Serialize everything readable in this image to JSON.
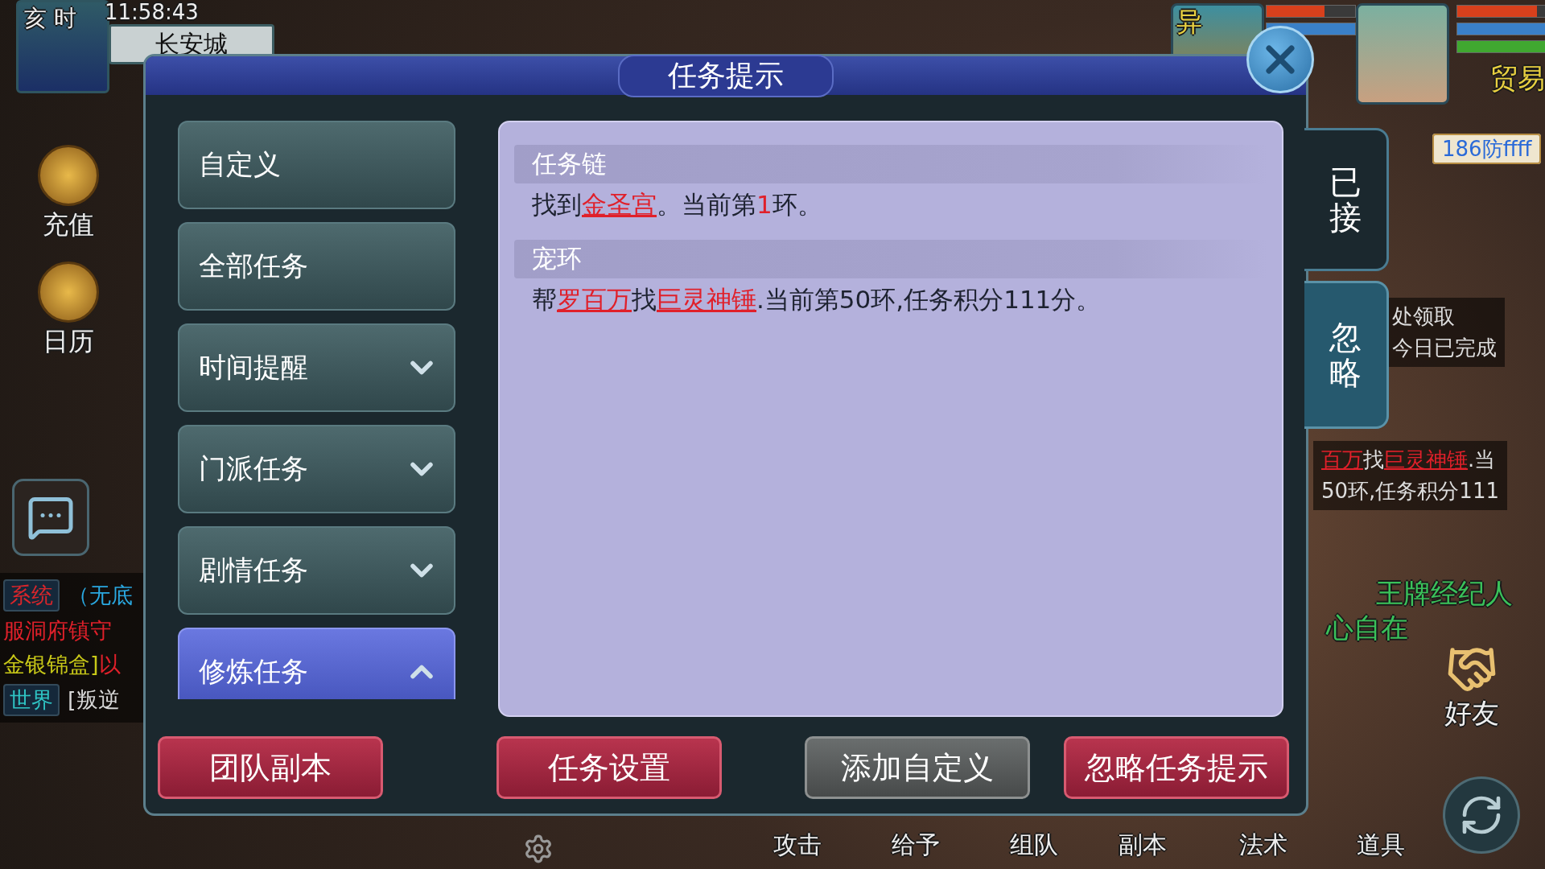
{
  "hud": {
    "period": "亥 时",
    "time": "11:58:43",
    "location": "长安城",
    "side_buttons": [
      {
        "label": "充值"
      },
      {
        "label": "日历"
      }
    ],
    "chat": [
      {
        "channel": "系统",
        "kind": "system",
        "segments": [
          {
            "text": "（无底",
            "kind": "npc"
          }
        ]
      },
      {
        "segments": [
          {
            "text": "服洞府镇守",
            "kind": "alert"
          }
        ]
      },
      {
        "segments": [
          {
            "text": "金银锦盒]",
            "kind": "item"
          },
          {
            "text": "以",
            "kind": "alert"
          }
        ]
      },
      {
        "channel": "世界",
        "kind": "world",
        "segments": [
          {
            "text": "[叛逆",
            "kind": "plain"
          }
        ]
      }
    ],
    "party": {
      "pet_tag": "异",
      "trade": "贸易",
      "name_tag": "186防ffff"
    },
    "tracker": [
      {
        "lines": [
          [
            {
              "text": "处领取",
              "kind": "plain"
            }
          ],
          [
            {
              "text": "今日已完成",
              "kind": "plain"
            }
          ]
        ]
      },
      {
        "lines": [
          [
            {
              "text": "百万",
              "kind": "link"
            },
            {
              "text": "找",
              "kind": "plain"
            },
            {
              "text": "巨灵神锤",
              "kind": "link"
            },
            {
              "text": ".当",
              "kind": "plain"
            }
          ],
          [
            {
              "text": "50环,任务积分111",
              "kind": "plain"
            }
          ]
        ]
      }
    ],
    "names": [
      "王牌经纪人",
      "心自在"
    ],
    "friends": "好友",
    "actions": [
      "攻击",
      "给予",
      "组队",
      "副本",
      "法术",
      "道具"
    ]
  },
  "dialog": {
    "title": "任务提示",
    "menu": [
      {
        "label": "自定义",
        "kind": "plain",
        "selected": false
      },
      {
        "label": "全部任务",
        "kind": "plain",
        "selected": false
      },
      {
        "label": "时间提醒",
        "kind": "group",
        "expanded": false,
        "selected": false
      },
      {
        "label": "门派任务",
        "kind": "group",
        "expanded": false,
        "selected": false
      },
      {
        "label": "剧情任务",
        "kind": "group",
        "expanded": false,
        "selected": false
      },
      {
        "label": "修炼任务",
        "kind": "group",
        "expanded": true,
        "selected": true
      }
    ],
    "sections": [
      {
        "title": "任务链",
        "segments": [
          {
            "text": "找到",
            "kind": "plain"
          },
          {
            "text": "金圣宫",
            "kind": "link"
          },
          {
            "text": "。当前第",
            "kind": "plain"
          },
          {
            "text": "1",
            "kind": "count"
          },
          {
            "text": "环。",
            "kind": "plain"
          }
        ]
      },
      {
        "title": "宠环",
        "segments": [
          {
            "text": "帮",
            "kind": "plain"
          },
          {
            "text": "罗百万",
            "kind": "link"
          },
          {
            "text": "找",
            "kind": "plain"
          },
          {
            "text": "巨灵神锤",
            "kind": "link"
          },
          {
            "text": ".当前第50环,任务积分111分。",
            "kind": "plain"
          }
        ]
      }
    ],
    "side_tabs": [
      {
        "label": "已接",
        "selected": true
      },
      {
        "label": "忽略",
        "selected": false
      }
    ],
    "buttons": [
      {
        "label": "团队副本",
        "kind": "accent"
      },
      {
        "label": "任务设置",
        "kind": "accent"
      },
      {
        "label": "添加自定义",
        "kind": "neutral"
      },
      {
        "label": "忽略任务提示",
        "kind": "accent"
      }
    ]
  }
}
